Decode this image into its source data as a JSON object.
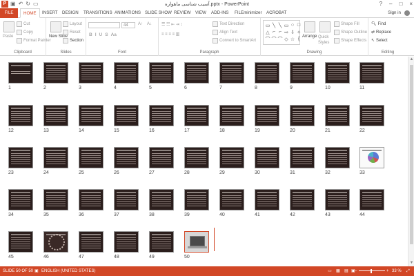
{
  "title_bar": {
    "window_title": "آسیب شناسی ماهواره.pptx - PowerPoint",
    "app_icon": "P",
    "qat_icons": [
      "save-icon",
      "undo-icon",
      "redo-icon",
      "start-from-beginning-icon"
    ],
    "controls": [
      "?",
      "–",
      "□",
      "×"
    ]
  },
  "tabs": {
    "file": "FILE",
    "items": [
      "HOME",
      "INSERT",
      "DESIGN",
      "TRANSITIONS",
      "ANIMATIONS",
      "SLIDE SHOW",
      "REVIEW",
      "VIEW",
      "ADD-INS",
      "FILEminimizer",
      "ACROBAT"
    ],
    "active": "HOME",
    "sign_in": "Sign in"
  },
  "ribbon": {
    "clipboard": {
      "label": "Clipboard",
      "paste": "Paste",
      "cut": "Cut",
      "copy": "Copy",
      "format_painter": "Format Painter"
    },
    "slides": {
      "label": "Slides",
      "new_slide": "New Slide",
      "layout": "Layout",
      "reset": "Reset",
      "section": "Section"
    },
    "font": {
      "label": "Font",
      "size_value": "44",
      "bold": "B",
      "italic": "I",
      "underline": "U",
      "strike": "S",
      "aa": "Aa"
    },
    "paragraph": {
      "label": "Paragraph",
      "text_direction": "Text Direction",
      "align_text": "Align Text",
      "convert": "Convert to SmartArt"
    },
    "drawing": {
      "label": "Drawing",
      "arrange": "Arrange",
      "quick_styles": "Quick Styles",
      "shape_fill": "Shape Fill",
      "shape_outline": "Shape Outline",
      "shape_effects": "Shape Effects"
    },
    "editing": {
      "label": "Editing",
      "find": "Find",
      "replace": "Replace",
      "select": "Select"
    },
    "shape_glyphs": [
      "▭",
      "╲",
      "╲",
      "▭",
      "○",
      "□",
      "△",
      "⌐",
      "⌐",
      "⇨",
      "⇩",
      "✧",
      "⌒",
      "⌒",
      "⌒",
      "◇",
      "☆",
      "{"
    ]
  },
  "slides": {
    "numbers": [
      "1",
      "2",
      "3",
      "4",
      "5",
      "6",
      "7",
      "8",
      "9",
      "10",
      "11",
      "12",
      "13",
      "14",
      "15",
      "16",
      "17",
      "18",
      "19",
      "20",
      "21",
      "22",
      "23",
      "24",
      "25",
      "26",
      "27",
      "28",
      "29",
      "30",
      "31",
      "32",
      "33",
      "34",
      "35",
      "36",
      "37",
      "38",
      "39",
      "40",
      "41",
      "42",
      "43",
      "44",
      "45",
      "46",
      "47",
      "48",
      "49",
      "50"
    ],
    "special": {
      "title_slide": 1,
      "chart_slide": 33,
      "ornament_slide": 46,
      "photo_slide": 50,
      "selected_slide": 50
    }
  },
  "status_bar": {
    "slide_info": "SLIDE 50 OF 50",
    "language": "ENGLISH (UNITED STATES)",
    "zoom": "33 %",
    "zoom_minus": "–",
    "zoom_plus": "+"
  },
  "colors": {
    "accent": "#d24726",
    "slide_bg": "#2b1e1c"
  }
}
